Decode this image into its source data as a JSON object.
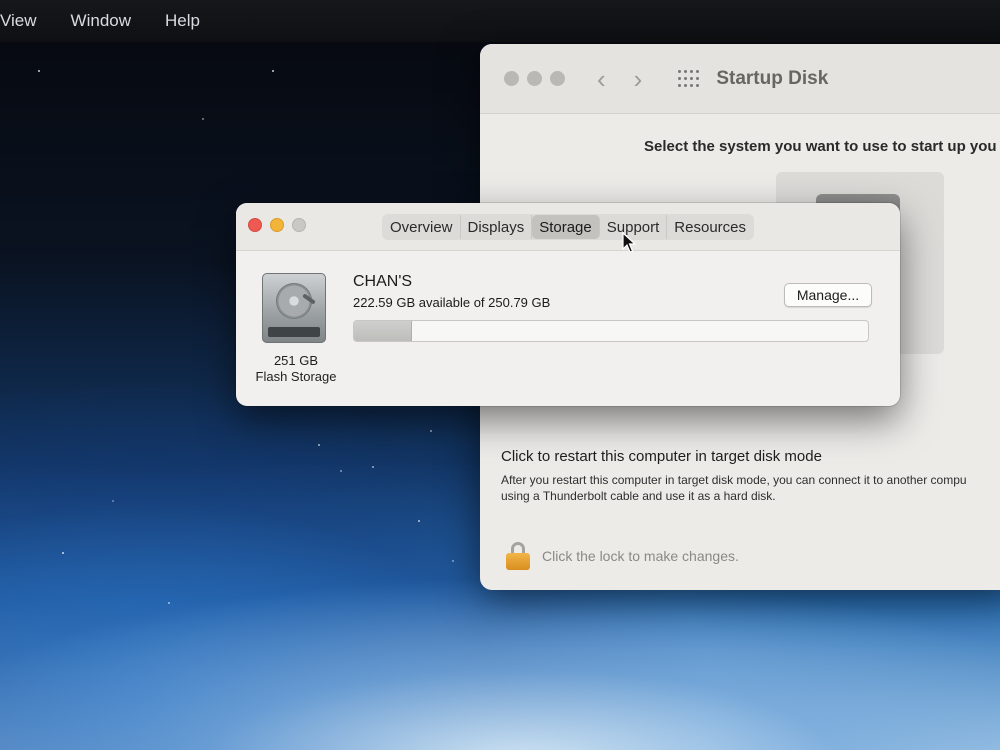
{
  "menubar": {
    "items": [
      "View",
      "Window",
      "Help"
    ]
  },
  "startup_disk": {
    "title": "Startup Disk",
    "prompt": "Select the system you want to use to start up you",
    "restart_title": "Click to restart this computer in target disk mode",
    "restart_desc_line1": "After you restart this computer in target disk mode, you can connect it to another compu",
    "restart_desc_line2": "using a Thunderbolt cable and use it as a hard disk.",
    "lock_text": "Click the lock to make changes.",
    "icons": {
      "back": "chevron-left-icon",
      "forward": "chevron-right-icon",
      "grid": "grid-icon",
      "lock": "lock-icon"
    }
  },
  "about": {
    "tabs": [
      "Overview",
      "Displays",
      "Storage",
      "Support",
      "Resources"
    ],
    "selected_tab": "Storage",
    "disk_size": "251 GB",
    "disk_type": "Flash Storage",
    "volume_name": "CHAN'S",
    "availability": "222.59 GB available of 250.79 GB",
    "manage_label": "Manage...",
    "used_fraction": 0.1125,
    "colors": {
      "close": "#ee5a52",
      "minimize": "#f3b43a",
      "zoom": "#c9c8c5"
    }
  }
}
